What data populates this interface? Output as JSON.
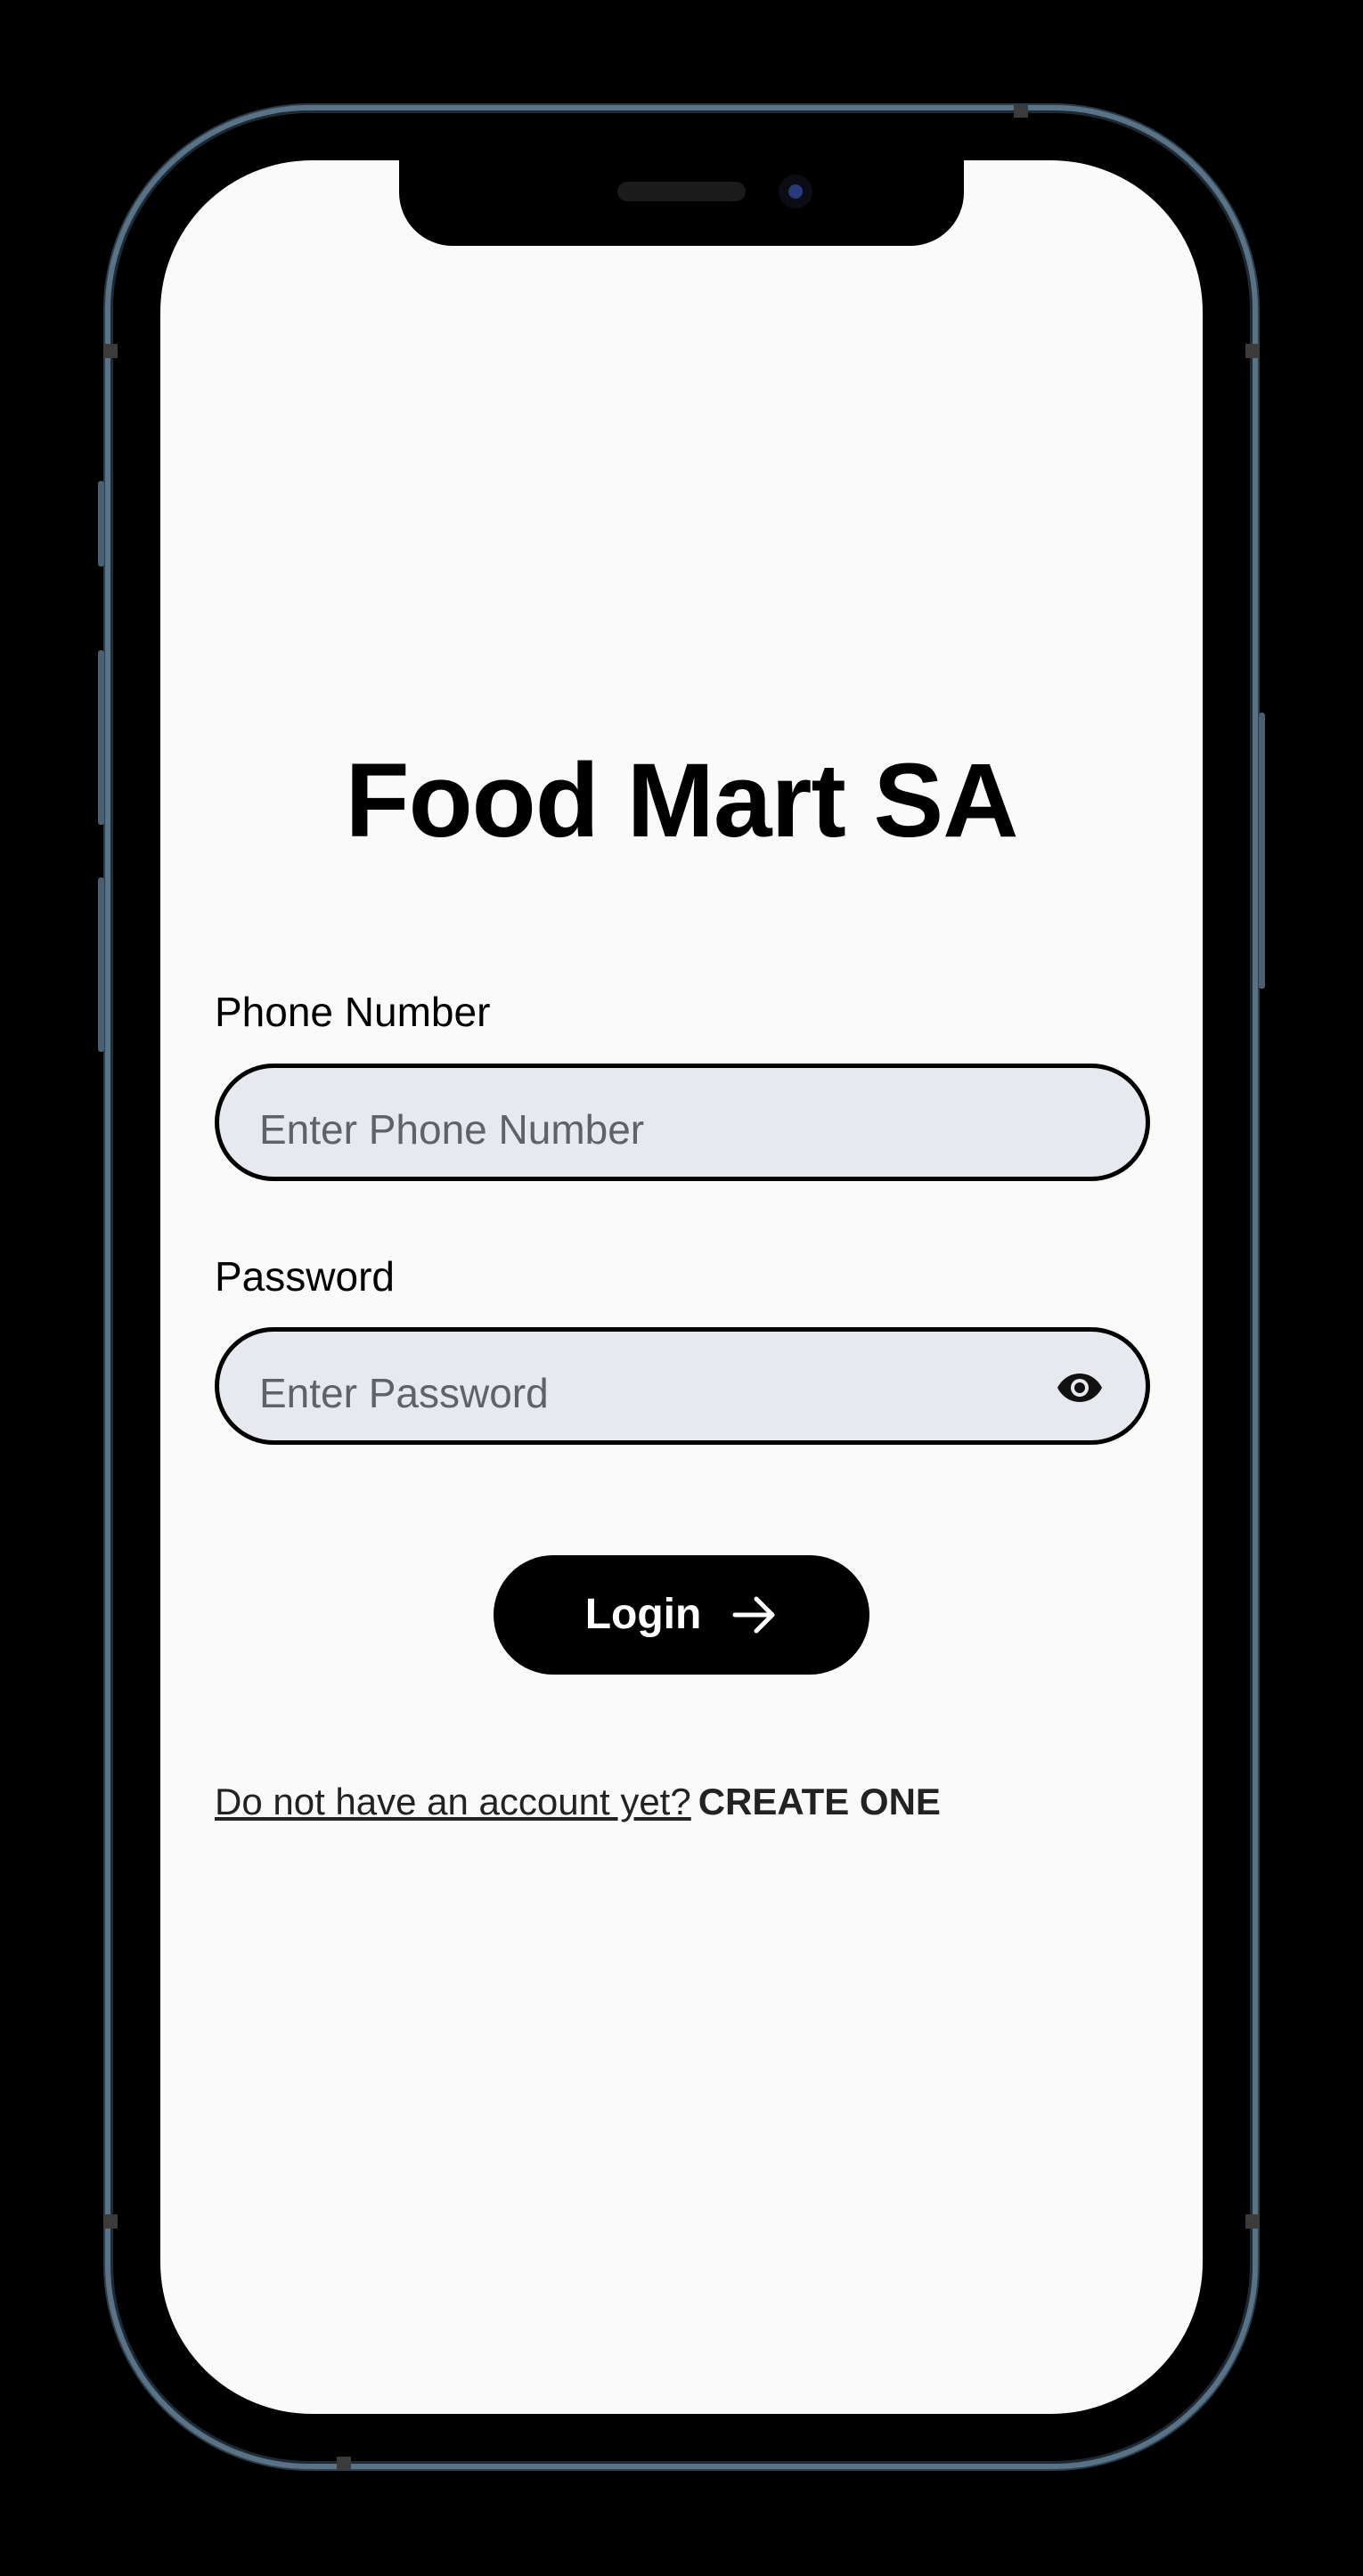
{
  "app": {
    "title": "Food Mart SA"
  },
  "form": {
    "phone": {
      "label": "Phone Number",
      "placeholder": "Enter Phone Number",
      "value": ""
    },
    "password": {
      "label": "Password",
      "placeholder": "Enter Password",
      "value": "",
      "toggle_icon": "eye-icon"
    },
    "login_button": {
      "label": "Login",
      "icon": "arrow-right-icon"
    }
  },
  "signup": {
    "question": "Do not have an account yet?",
    "link": "CREATE ONE"
  },
  "colors": {
    "background": "#fafafa",
    "field_fill": "#e6e9ee",
    "accent": "#000000",
    "placeholder": "#5f6368"
  }
}
